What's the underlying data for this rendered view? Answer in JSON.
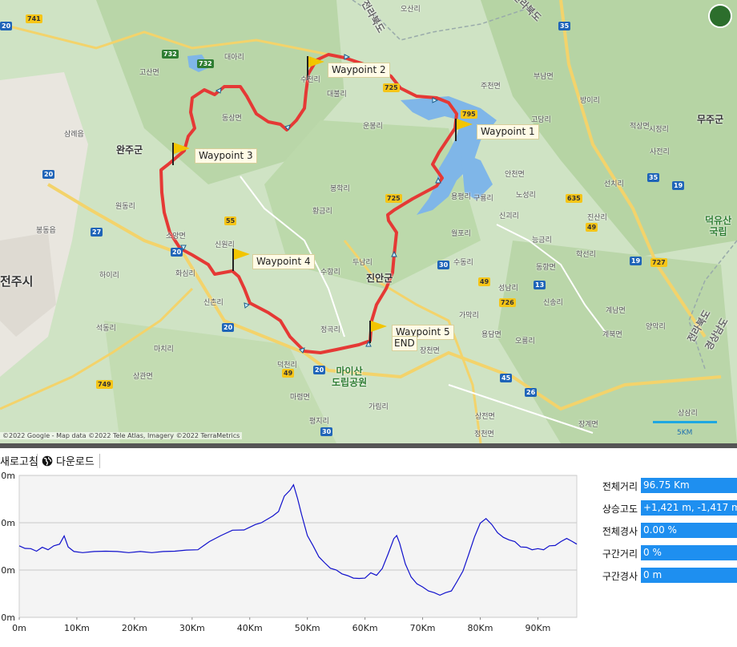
{
  "map": {
    "attribution": "©2022 Google - Map data ©2022 Tele Atlas, Imagery ©2022 TerraMetrics",
    "scale_label": "5KM",
    "waypoints": [
      {
        "label": "Waypoint 1"
      },
      {
        "label": "Waypoint 2"
      },
      {
        "label": "Waypoint 3"
      },
      {
        "label": "Waypoint 4"
      },
      {
        "label": "Waypoint 5"
      }
    ],
    "end_label": "END",
    "labels": {
      "wanju": "완주군",
      "jeonju": "전주시",
      "jinan": "진안군",
      "muju": "무주군",
      "maisan": "마이산\n도립공원",
      "deokyu": "덕유산\n국립",
      "jeonbuk": "전라북도",
      "jeonbuk2": "전라북도",
      "gyeongnam": "경상남도",
      "jeonbuk_mid": "전라북도"
    },
    "route_numbers": [
      "741",
      "732",
      "795",
      "725",
      "55",
      "635",
      "49",
      "30",
      "20",
      "27",
      "35",
      "19",
      "727",
      "26",
      "749",
      "13",
      "45",
      "726"
    ],
    "towns": [
      "수천리",
      "동상면",
      "대아리",
      "고산면",
      "오산리",
      "운봉리",
      "봉학리",
      "황금리",
      "두남리",
      "수항리",
      "신원리",
      "정곡리",
      "가림리",
      "평지리",
      "마령면",
      "덕천리",
      "상전면",
      "월포리",
      "용평리",
      "구룡리",
      "정천면",
      "신괴리",
      "상삼리",
      "안천면",
      "진산리",
      "적상면",
      "부남면",
      "방이리",
      "고당리",
      "능금리",
      "학선리",
      "동향면",
      "가막리",
      "용담면",
      "성남리",
      "신송리",
      "오룡리",
      "장계면",
      "계북면",
      "계남면",
      "양악리",
      "시정리",
      "사전리",
      "선치리",
      "주천면",
      "대불리",
      "노성리",
      "수동리",
      "장천면",
      "봉동읍",
      "삼례읍",
      "소양면",
      "화심리",
      "신촌리",
      "상관면",
      "원동리",
      "하이리",
      "석동리",
      "마치리"
    ]
  },
  "toolbar": {
    "refresh_label": "새로고침",
    "download_label": "다운로드"
  },
  "stats": {
    "total_distance": {
      "label": "전체거리",
      "value": "96.75 Km"
    },
    "climb": {
      "label": "상승고도",
      "value": "+1,421 m, -1,417 m"
    },
    "total_grade": {
      "label": "전체경사",
      "value": "0.00 %"
    },
    "section_distance": {
      "label": "구간거리",
      "value": "0 %"
    },
    "section_grade": {
      "label": "구간경사",
      "value": "0 m"
    }
  },
  "colors": {
    "route": "#e53935",
    "profile_line": "#1010cc",
    "stat_bg": "#1e8ff0",
    "map_bg": "#cfe3c4"
  },
  "chart_data": {
    "type": "line",
    "title": "",
    "xlabel": "",
    "ylabel": "",
    "x_tick_labels": [
      "0m",
      "10Km",
      "20Km",
      "30Km",
      "40Km",
      "50Km",
      "60Km",
      "70Km",
      "80Km",
      "90Km"
    ],
    "y_tick_labels": [
      "0m",
      "0m",
      "0m",
      "0m"
    ],
    "xlim": [
      0,
      96.75
    ],
    "ylim": [
      0,
      1.0
    ],
    "grid": true,
    "series": [
      {
        "x": [
          0,
          1,
          2,
          3,
          4,
          5,
          6,
          7,
          7.8,
          8.5,
          9.5,
          11,
          13,
          15,
          17,
          19,
          21,
          23,
          25,
          27,
          29,
          31,
          33,
          35,
          37,
          39,
          41,
          42,
          44,
          45,
          46,
          47,
          47.6,
          48.3,
          49,
          50,
          51,
          52,
          53,
          54,
          55,
          56,
          57,
          58,
          59,
          60,
          61,
          62,
          63,
          64,
          65,
          65.5,
          66,
          67,
          68,
          69,
          70,
          71,
          72,
          73,
          74,
          75,
          76,
          77,
          78,
          79,
          80,
          81,
          82,
          83,
          84,
          85,
          86,
          87,
          88,
          89,
          90,
          91,
          92,
          93,
          94,
          95,
          96,
          96.75
        ],
        "y": [
          0.5,
          0.49,
          0.48,
          0.47,
          0.49,
          0.48,
          0.5,
          0.52,
          0.57,
          0.5,
          0.46,
          0.46,
          0.46,
          0.47,
          0.46,
          0.46,
          0.46,
          0.46,
          0.46,
          0.47,
          0.47,
          0.48,
          0.53,
          0.58,
          0.61,
          0.62,
          0.65,
          0.67,
          0.71,
          0.75,
          0.85,
          0.9,
          0.93,
          0.84,
          0.72,
          0.58,
          0.5,
          0.43,
          0.38,
          0.35,
          0.33,
          0.31,
          0.29,
          0.28,
          0.27,
          0.28,
          0.31,
          0.3,
          0.34,
          0.45,
          0.55,
          0.58,
          0.52,
          0.38,
          0.28,
          0.24,
          0.21,
          0.19,
          0.17,
          0.16,
          0.17,
          0.19,
          0.25,
          0.33,
          0.44,
          0.57,
          0.66,
          0.7,
          0.65,
          0.6,
          0.56,
          0.55,
          0.53,
          0.5,
          0.49,
          0.48,
          0.48,
          0.48,
          0.5,
          0.51,
          0.53,
          0.56,
          0.53,
          0.52
        ]
      }
    ]
  }
}
